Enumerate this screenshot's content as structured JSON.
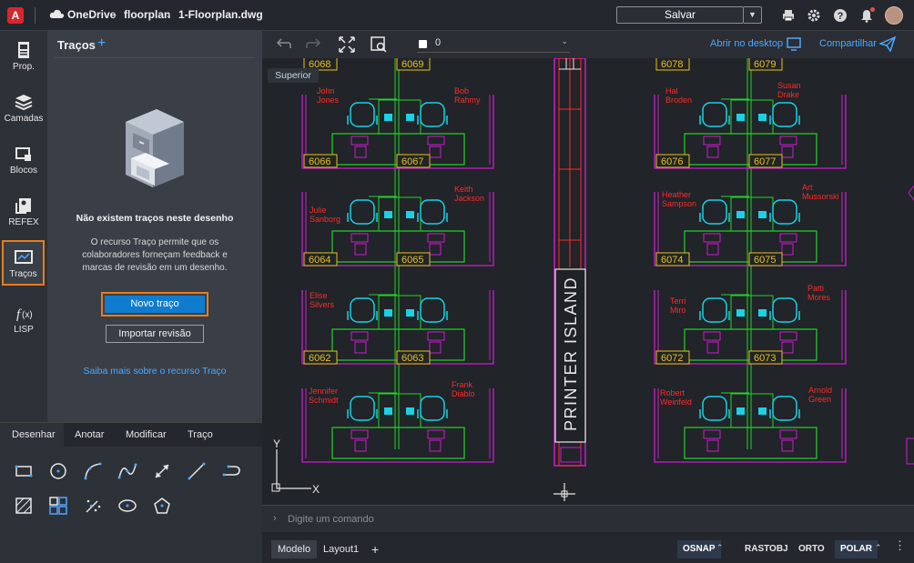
{
  "topbar": {
    "product": "OneDrive",
    "folder": "floorplan",
    "file": "1-Floorplan.dwg",
    "save_label": "Salvar"
  },
  "leftbar": {
    "items": [
      {
        "label": "Prop."
      },
      {
        "label": "Camadas"
      },
      {
        "label": "Blocos"
      },
      {
        "label": "REFEX"
      },
      {
        "label": "Traços"
      },
      {
        "label": "LISP"
      }
    ]
  },
  "panel": {
    "title": "Traços",
    "empty_title": "Não existem traços neste desenho",
    "empty_desc": "O recurso Traço permite que os colaboradores forneçam feedback e marcas de revisão em um desenho.",
    "new_button": "Novo traço",
    "import_button": "Importar revisão",
    "learn_link": "Saiba mais sobre o recurso Traço"
  },
  "tools": {
    "tabs": [
      "Desenhar",
      "Anotar",
      "Modificar",
      "Traço"
    ],
    "icons": [
      "rectangle-icon",
      "circle-icon",
      "arc-icon",
      "spline-icon",
      "dimension-icon",
      "line-icon",
      "polyline-icon",
      "hatch-icon",
      "array-icon",
      "scatter-icon",
      "ellipse-icon",
      "polygon-icon"
    ]
  },
  "canvas": {
    "layer_value": "0",
    "open_desktop": "Abrir no desktop",
    "share": "Compartilhar",
    "view_label": "Superior",
    "printer_island": "PRINTER  ISLAND",
    "axis_y": "Y",
    "axis_x": "X",
    "room_numbers": [
      "6068",
      "6069",
      "6078",
      "6079",
      "6066",
      "6067",
      "6076",
      "6077",
      "6064",
      "6065",
      "6074",
      "6075",
      "6062",
      "6063",
      "6072",
      "6073"
    ],
    "names": [
      {
        "first": "John",
        "last": "Jones"
      },
      {
        "first": "Bob",
        "last": "Rahmy"
      },
      {
        "first": "Hal",
        "last": "Broden"
      },
      {
        "first": "Susan",
        "last": "Drake"
      },
      {
        "first": "Keith",
        "last": "Jackson"
      },
      {
        "first": "Julie",
        "last": "Sanborg"
      },
      {
        "first": "Heather",
        "last": "Sampson"
      },
      {
        "first": "Art",
        "last": "Mussorski"
      },
      {
        "first": "Elise",
        "last": "Silvers"
      },
      {
        "first": "Terri",
        "last": "Miro"
      },
      {
        "first": "Patti",
        "last": "Mores"
      },
      {
        "first": "Jennifer",
        "last": "Schmidt"
      },
      {
        "first": "Frank",
        "last": "Diablo"
      },
      {
        "first": "Robert",
        "last": "Weinfeld"
      },
      {
        "first": "Arnold",
        "last": "Green"
      }
    ]
  },
  "command": {
    "placeholder": "Digite um comando"
  },
  "status": {
    "tabs": [
      "Modelo",
      "Layout1"
    ],
    "buttons": [
      "OSNAP",
      "RASTOBJ",
      "ORTO",
      "POLAR"
    ]
  },
  "colors": {
    "accent": "#e87d1a",
    "link": "#4da8ff",
    "primary_button": "#0f7ccf",
    "cad_magenta": "#d01ad6",
    "cad_green": "#22d42a",
    "cad_cyan": "#19d2e6",
    "cad_yellow": "#e8c21a",
    "cad_red": "#ff2a2a"
  }
}
